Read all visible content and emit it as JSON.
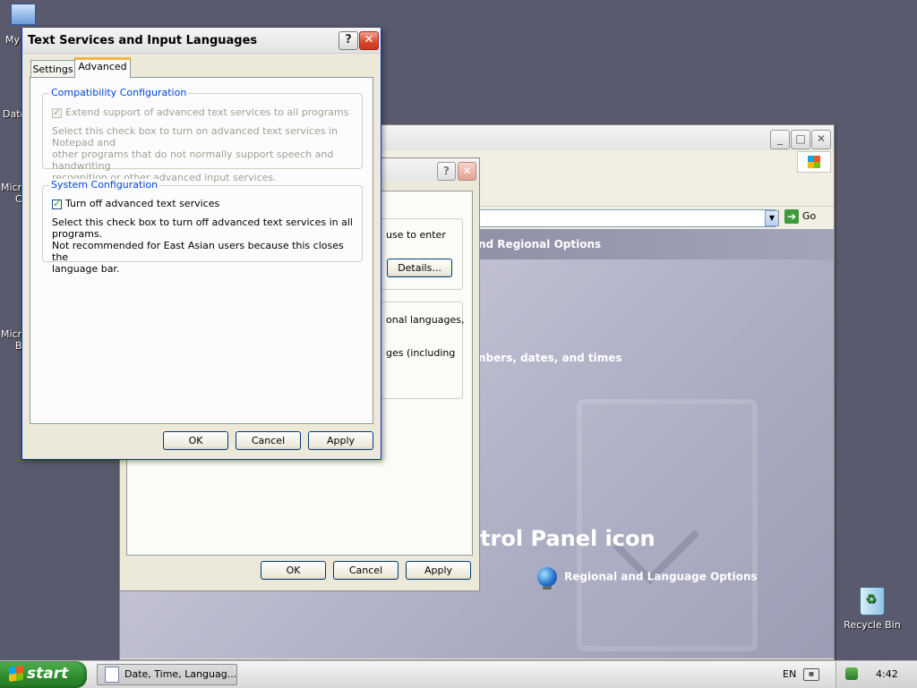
{
  "desktop": {
    "icon_my_computer": "My",
    "label_date": "Date",
    "label_micro1_line1": "Micro",
    "label_micro1_line2": "C",
    "label_micro2_line1": "Micro",
    "label_micro2_line2": "B",
    "recycle_bin": "Recycle Bin"
  },
  "control_panel": {
    "section_header": "nd Regional Options",
    "subtitle": "nbers, dates, and times",
    "big_title": "ntrol Panel icon",
    "regional_item": "Regional and Language Options",
    "go_label": "Go"
  },
  "mid_dialog": {
    "text1": "use to enter",
    "details_button": "Details...",
    "text2_line1": "onal languages,",
    "text2_line2": "ges (including",
    "ok": "OK",
    "cancel": "Cancel",
    "apply": "Apply"
  },
  "dialog": {
    "title": "Text Services and Input Languages",
    "help_glyph": "?",
    "close_glyph": "✕",
    "tabs": [
      "Settings",
      "Advanced"
    ],
    "active_tab": "Advanced",
    "compat": {
      "legend": "Compatibility Configuration",
      "checkbox_label": "Extend support of advanced text services to all programs",
      "checked": true,
      "enabled": false,
      "description_lines": [
        "Select this check box to turn on advanced text services in Notepad and",
        "other programs that do not normally support speech and handwriting",
        "recognition or other advanced input services."
      ]
    },
    "system": {
      "legend": "System Configuration",
      "checkbox_label": "Turn off advanced text services",
      "checked": true,
      "description_lines": [
        "Select this check box to turn off advanced text services in all programs.",
        "Not recommended for East Asian users because this closes the",
        "language bar."
      ]
    },
    "buttons": {
      "ok": "OK",
      "cancel": "Cancel",
      "apply": "Apply"
    }
  },
  "taskbar": {
    "start_label": "start",
    "task_item": "Date, Time, Languag...",
    "language": "EN",
    "clock": "4:42"
  },
  "colors": {
    "desktop": "#5a5a6e",
    "legend_blue": "#0046d5",
    "start_green": "#2e8a2e",
    "close_red": "#d9472b"
  }
}
